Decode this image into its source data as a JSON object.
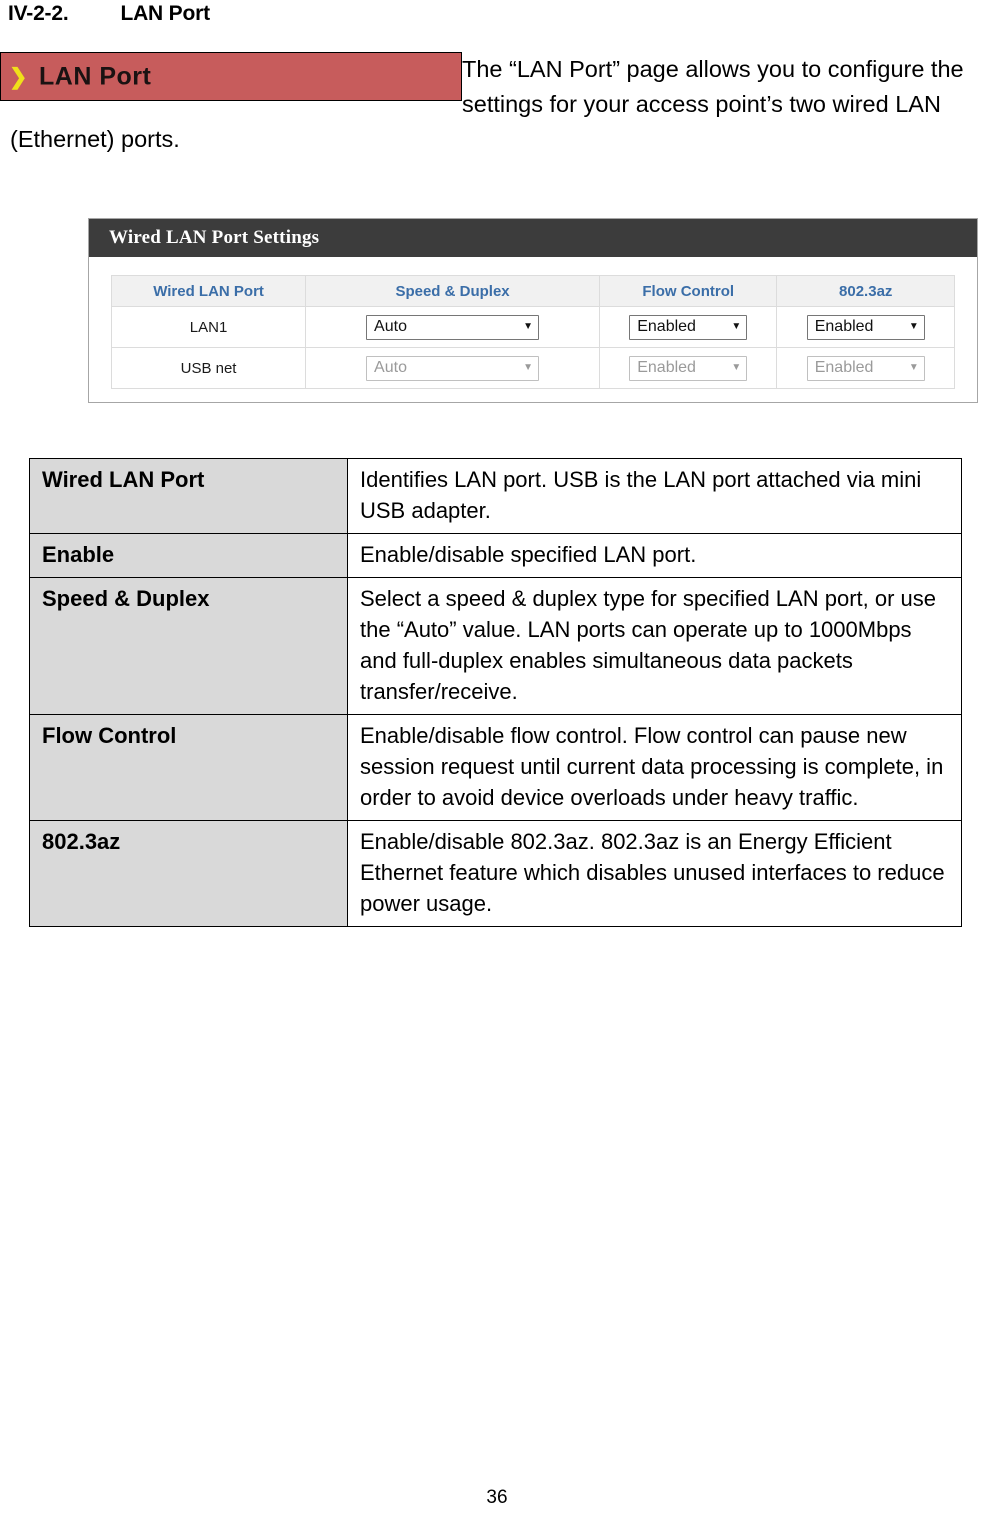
{
  "heading": {
    "number": "IV-2-2.",
    "title": "LAN Port"
  },
  "banner": {
    "chevron": "chevron-right-icon",
    "chevron_glyph": "❯",
    "label": "LAN Port",
    "background_color": "#c75c5c",
    "chevron_color": "#f0e01a"
  },
  "intro": {
    "text": "The “LAN Port” page allows you to configure the settings for your access point’s two wired LAN (Ethernet) ports."
  },
  "screenshot": {
    "panel_title": "Wired LAN Port Settings",
    "titlebar_color": "#3c3c3c",
    "header_text_color": "#3b6ea8",
    "columns": [
      "Wired LAN Port",
      "Speed & Duplex",
      "Flow Control",
      "802.3az"
    ],
    "rows": [
      {
        "port": "LAN1",
        "speed_duplex": "Auto",
        "flow_control": "Enabled",
        "az": "Enabled",
        "disabled": false
      },
      {
        "port": "USB net",
        "speed_duplex": "Auto",
        "flow_control": "Enabled",
        "az": "Enabled",
        "disabled": true
      }
    ],
    "caret_glyph": "▼"
  },
  "description_table": {
    "rows": [
      {
        "label": "Wired LAN Port",
        "value": "Identifies LAN port. USB is the LAN port attached via mini USB adapter."
      },
      {
        "label": "Enable",
        "value": "Enable/disable specified LAN port."
      },
      {
        "label": "Speed & Duplex",
        "value": "Select a speed & duplex type for specified LAN port, or use the “Auto” value. LAN ports can operate up to 1000Mbps and full-duplex enables simultaneous data packets transfer/receive."
      },
      {
        "label": "Flow Control",
        "value": "Enable/disable flow control. Flow control can pause new session request until current data processing is complete, in order to avoid device overloads under heavy traffic."
      },
      {
        "label": "802.3az",
        "value": "Enable/disable 802.3az. 802.3az is an Energy Efficient Ethernet feature which disables unused interfaces to reduce power usage."
      }
    ]
  },
  "footer": {
    "page_number": "36"
  }
}
